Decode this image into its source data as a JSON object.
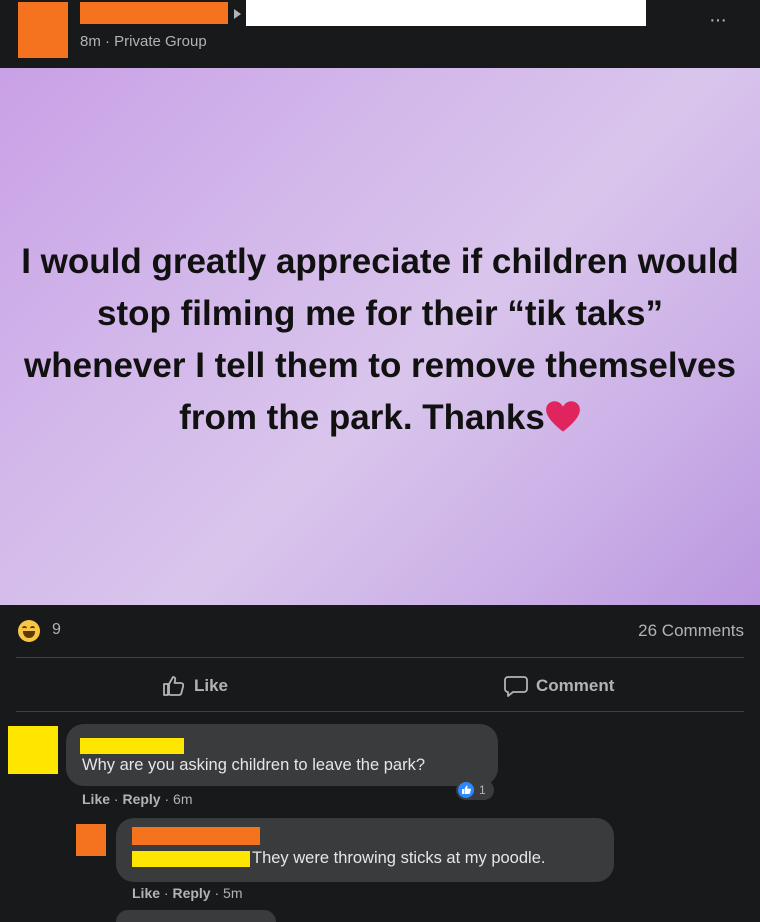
{
  "post": {
    "meta": "8m · Private Group",
    "more_label": "···",
    "text": "I would greatly appreciate if children would stop filming me for their “tik taks” whenever I tell them to remove themselves from the park. Thanks"
  },
  "stats": {
    "reaction_count": "9",
    "comments_count": "26 Comments"
  },
  "actions": {
    "like_label": "Like",
    "comment_label": "Comment"
  },
  "comments": [
    {
      "text": "Why are you asking children to leave the park?",
      "like": "Like",
      "reply": "Reply",
      "time": "6m",
      "like_count": "1"
    },
    {
      "text": "They were throwing sticks at my poodle.",
      "like": "Like",
      "reply": "Reply",
      "time": "5m"
    }
  ],
  "colors": {
    "background": "#18191a",
    "redaction_orange": "#f5731e",
    "redaction_yellow": "#ffe600",
    "bubble": "#3a3b3c",
    "heart": "#e0245e"
  }
}
